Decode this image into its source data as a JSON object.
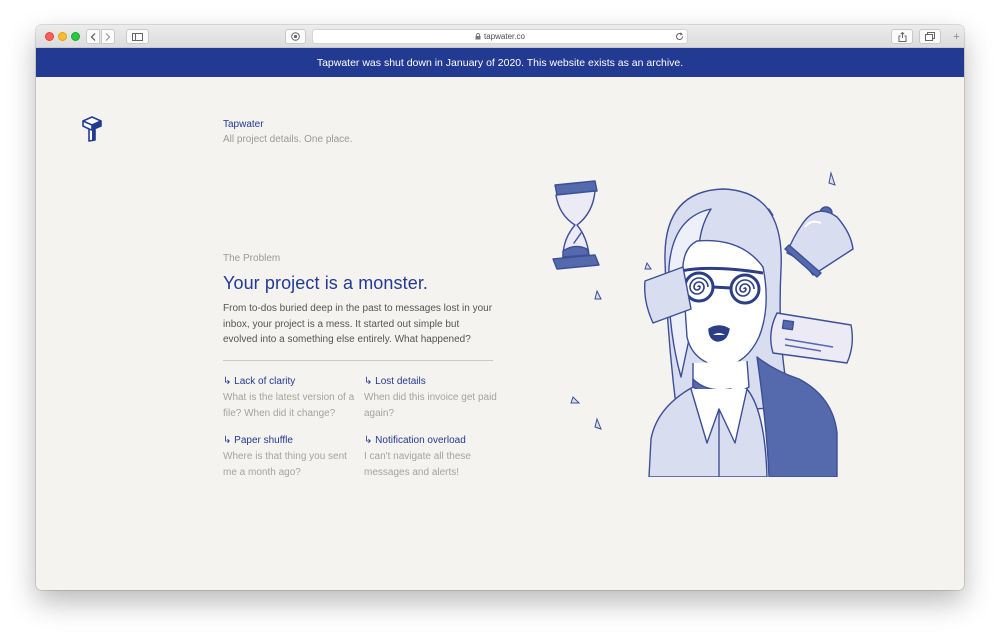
{
  "browser": {
    "url": "tapwater.co"
  },
  "banner": {
    "text": "Tapwater was shut down in January of 2020. This website exists as an archive."
  },
  "header": {
    "brand": "Tapwater",
    "tagline": "All project details. One place."
  },
  "problem": {
    "eyebrow": "The Problem",
    "headline": "Your project is a monster.",
    "lede": "From to-dos buried deep in the past to messages lost in your inbox, your project is a mess. It started out simple but evolved into a something else entirely. What happened?"
  },
  "features": [
    {
      "title": "↳ Lack of clarity",
      "body": "What is the latest version of a file? When did it change?"
    },
    {
      "title": "↳ Lost details",
      "body": "When did this invoice get paid again?"
    },
    {
      "title": "↳ Paper shuffle",
      "body": "Where is that thing you sent me a month ago?"
    },
    {
      "title": "↳ Notification overload",
      "body": "I can't navigate all these messages and alerts!"
    }
  ],
  "colors": {
    "brand_blue": "#233a93",
    "illustration_blue": "#5569ad",
    "illustration_fill": "#d9ddf0",
    "page_background": "#f4f3ef"
  }
}
